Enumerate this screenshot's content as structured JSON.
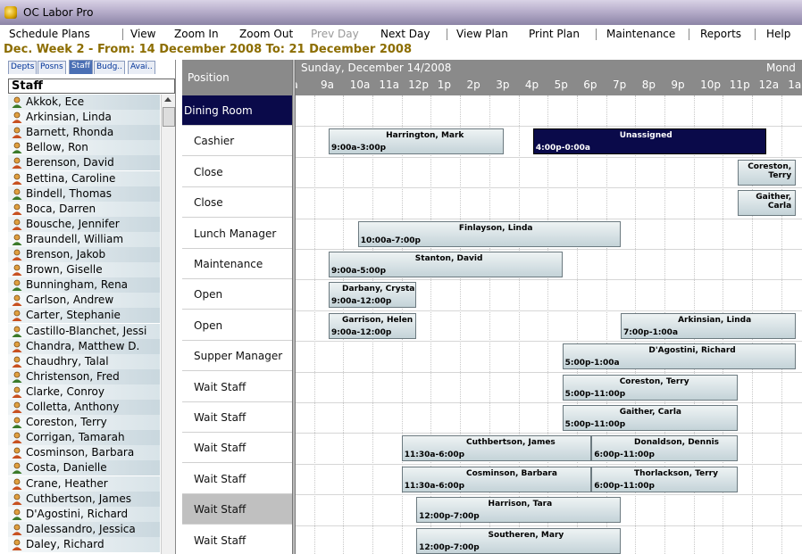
{
  "app": {
    "title": "OC Labor Pro"
  },
  "menu": {
    "schedule_plans": "Schedule Plans",
    "view": "View",
    "zoom_in": "Zoom In",
    "zoom_out": "Zoom Out",
    "prev_day": "Prev Day",
    "next_day": "Next Day",
    "view_plan": "View Plan",
    "print_plan": "Print Plan",
    "maintenance": "Maintenance",
    "reports": "Reports",
    "help": "Help"
  },
  "week_heading": "Dec. Week 2 - From: 14 December 2008 To: 21 December 2008",
  "left_panel": {
    "tabs": [
      "Depts",
      "Posns",
      "Staff",
      "Budg..",
      "Avai.."
    ],
    "active_tab": "Staff",
    "header": "Staff",
    "staff": [
      "Akkok, Ece",
      "Arkinsian, Linda",
      "Barnett, Rhonda",
      "Bellow, Ron",
      "Berenson, David",
      "Bettina, Caroline",
      "Bindell, Thomas",
      "Boca, Darren",
      "Bousche, Jennifer",
      "Braundell, William",
      "Brenson, Jakob",
      "Brown, Giselle",
      "Bunningham, Rena",
      "Carlson, Andrew",
      "Carter, Stephanie",
      "Castillo-Blanchet, Jessi",
      "Chandra, Matthew D.",
      "Chaudhry, Talal",
      "Christenson, Fred",
      "Clarke, Conroy",
      "Colletta, Anthony",
      "Coreston, Terry",
      "Corrigan, Tamarah",
      "Cosminson, Barbara",
      "Costa, Danielle",
      "Crane, Heather",
      "Cuthbertson, James",
      "D'Agostini, Richard",
      "Dalessandro, Jessica",
      "Daley, Richard"
    ]
  },
  "schedule": {
    "position_header": "Position",
    "date_label": "Sunday, December 14/2008",
    "next_day_label": "Mond",
    "hours": [
      "a",
      "9a",
      "10a",
      "11a",
      "12p",
      "1p",
      "2p",
      "3p",
      "4p",
      "5p",
      "6p",
      "7p",
      "8p",
      "9p",
      "10p",
      "11p",
      "12a",
      "1a"
    ],
    "positions": [
      "Dining Room",
      "Cashier",
      "Close",
      "Close",
      "Lunch Manager",
      "Maintenance",
      "Open",
      "Open",
      "Supper Manager",
      "Wait Staff",
      "Wait Staff",
      "Wait Staff",
      "Wait Staff",
      "Wait Staff",
      "Wait Staff"
    ],
    "shifts": [
      {
        "row": 1,
        "name": "Harrington, Mark",
        "time": "9:00a-3:00p",
        "start": 9.0,
        "end": 15.0,
        "dark": false
      },
      {
        "row": 1,
        "name": "Unassigned",
        "time": "4:00p-0:00a",
        "start": 16.0,
        "end": 24.0,
        "dark": true
      },
      {
        "row": 2,
        "name": "Coreston, Terry",
        "time": "",
        "start": 23.0,
        "end": 25.0,
        "dark": false
      },
      {
        "row": 3,
        "name": "Gaither, Carla",
        "time": "",
        "start": 23.0,
        "end": 25.0,
        "dark": false
      },
      {
        "row": 4,
        "name": "Finlayson, Linda",
        "time": "10:00a-7:00p",
        "start": 10.0,
        "end": 19.0,
        "dark": false
      },
      {
        "row": 5,
        "name": "Stanton, David",
        "time": "9:00a-5:00p",
        "start": 9.0,
        "end": 17.0,
        "dark": false
      },
      {
        "row": 6,
        "name": "Darbany, Crystal",
        "time": "9:00a-12:00p",
        "start": 9.0,
        "end": 12.0,
        "dark": false
      },
      {
        "row": 7,
        "name": "Garrison, Helen",
        "time": "9:00a-12:00p",
        "start": 9.0,
        "end": 12.0,
        "dark": false
      },
      {
        "row": 7,
        "name": "Arkinsian, Linda",
        "time": "7:00p-1:00a",
        "start": 19.0,
        "end": 25.0,
        "dark": false
      },
      {
        "row": 8,
        "name": "D'Agostini, Richard",
        "time": "5:00p-1:00a",
        "start": 17.0,
        "end": 25.0,
        "dark": false
      },
      {
        "row": 9,
        "name": "Coreston, Terry",
        "time": "5:00p-11:00p",
        "start": 17.0,
        "end": 23.0,
        "dark": false
      },
      {
        "row": 10,
        "name": "Gaither, Carla",
        "time": "5:00p-11:00p",
        "start": 17.0,
        "end": 23.0,
        "dark": false
      },
      {
        "row": 11,
        "name": "Cuthbertson, James",
        "time": "11:30a-6:00p",
        "start": 11.5,
        "end": 18.0,
        "dark": false
      },
      {
        "row": 11,
        "name": "Donaldson, Dennis",
        "time": "6:00p-11:00p",
        "start": 18.0,
        "end": 23.0,
        "dark": false
      },
      {
        "row": 12,
        "name": "Cosminson, Barbara",
        "time": "11:30a-6:00p",
        "start": 11.5,
        "end": 18.0,
        "dark": false
      },
      {
        "row": 12,
        "name": "Thorlackson, Terry",
        "time": "6:00p-11:00p",
        "start": 18.0,
        "end": 23.0,
        "dark": false
      },
      {
        "row": 13,
        "name": "Harrison, Tara",
        "time": "12:00p-7:00p",
        "start": 12.0,
        "end": 19.0,
        "dark": false
      },
      {
        "row": 14,
        "name": "Southeren, Mary",
        "time": "12:00p-7:00p",
        "start": 12.0,
        "end": 19.0,
        "dark": false
      }
    ],
    "selected_row": 13
  },
  "colors": {
    "week_heading": "#8c6d00",
    "dining_room_bg": "#0a0a4a",
    "unassigned_bg": "#0a0a4a",
    "header_bg": "#8a8a8a"
  }
}
